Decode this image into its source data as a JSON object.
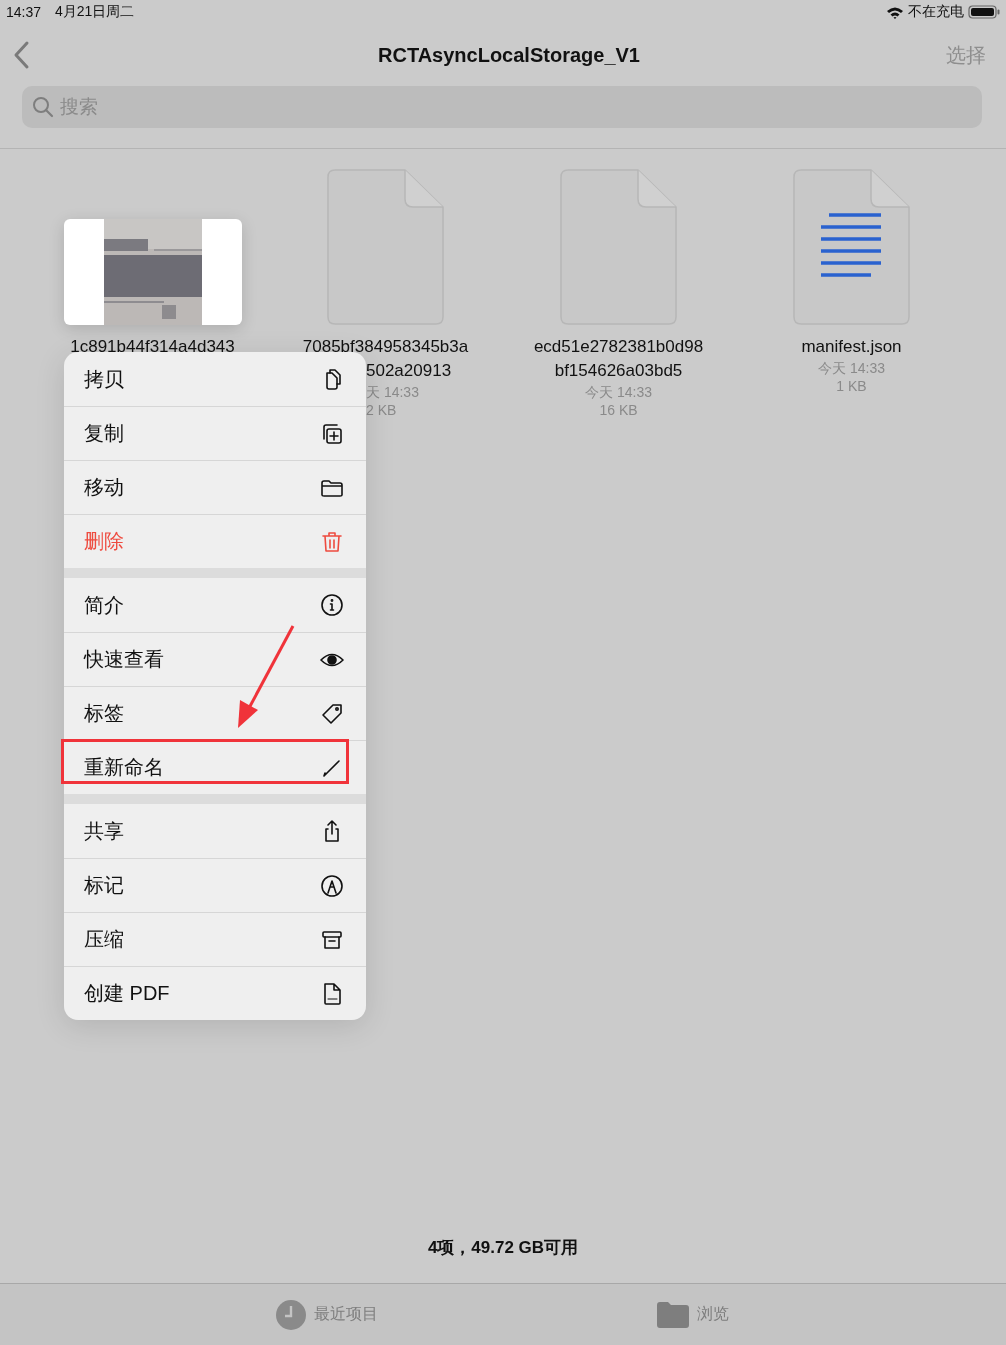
{
  "status_bar": {
    "time": "14:37",
    "date": "4月21日周二",
    "charging": "不在充电"
  },
  "nav": {
    "title": "RCTAsyncLocalStorage_V1",
    "action": "选择"
  },
  "search": {
    "placeholder": "搜索"
  },
  "files": [
    {
      "kind": "thumbnail",
      "name_lines": [
        "1c891b44f314a4d343"
      ]
    },
    {
      "kind": "covered",
      "name_lines": [
        "7085bf384958345b3a",
        "502a20913"
      ],
      "date": "天 14:33",
      "size": "2 KB"
    },
    {
      "kind": "blank",
      "name_lines": [
        "ecd51e2782381b0d98",
        "bf154626a03bd5"
      ],
      "date": "今天 14:33",
      "size": "16 KB"
    },
    {
      "kind": "text",
      "name_lines": [
        "manifest.json"
      ],
      "date": "今天 14:33",
      "size": "1 KB"
    }
  ],
  "menu": {
    "groups": [
      [
        {
          "label": "拷贝",
          "destructive": false,
          "highlighted": false
        },
        {
          "label": "复制",
          "destructive": false,
          "highlighted": false
        },
        {
          "label": "移动",
          "destructive": false,
          "highlighted": false
        },
        {
          "label": "删除",
          "destructive": true,
          "highlighted": false
        }
      ],
      [
        {
          "label": "简介",
          "destructive": false,
          "highlighted": false
        },
        {
          "label": "快速查看",
          "destructive": false,
          "highlighted": false
        },
        {
          "label": "标签",
          "destructive": false,
          "highlighted": false
        },
        {
          "label": "重新命名",
          "destructive": false,
          "highlighted": true
        }
      ],
      [
        {
          "label": "共享",
          "destructive": false,
          "highlighted": false
        },
        {
          "label": "标记",
          "destructive": false,
          "highlighted": false
        },
        {
          "label": "压缩",
          "destructive": false,
          "highlighted": false
        },
        {
          "label": "创建 PDF",
          "destructive": false,
          "highlighted": false
        }
      ]
    ]
  },
  "summary": "4项，49.72 GB可用",
  "tabs": [
    {
      "label": "最近项目",
      "selected": false
    },
    {
      "label": "浏览",
      "selected": false
    }
  ]
}
